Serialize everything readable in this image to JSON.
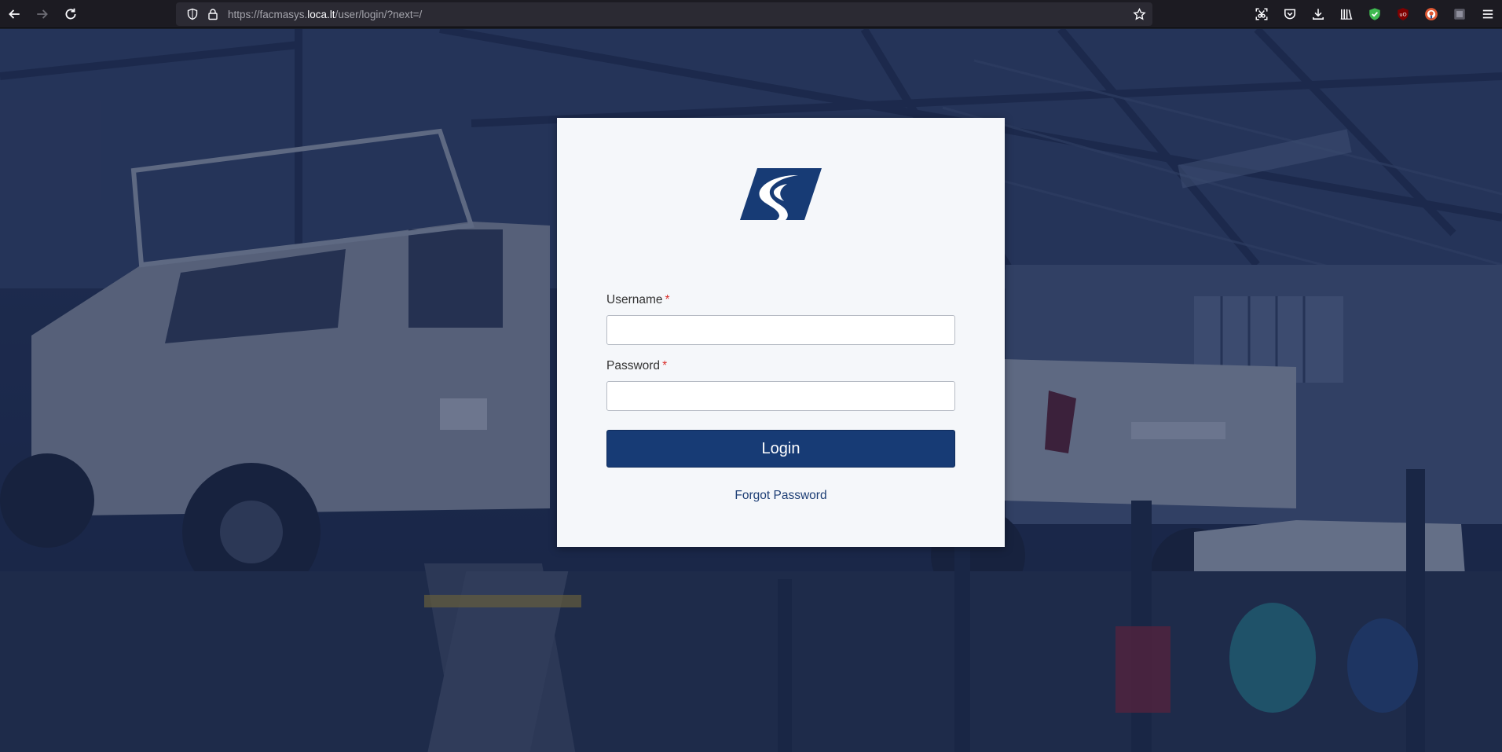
{
  "browser": {
    "url_prefix": "https://facmasys.",
    "url_host": "loca.lt",
    "url_path": "/user/login/?next=/",
    "nav_icons": [
      "back-arrow-icon",
      "forward-arrow-icon",
      "reload-icon"
    ],
    "url_icons": [
      "shield-icon",
      "lock-icon"
    ],
    "toolbar_icons": [
      "screenshot-icon",
      "pocket-icon",
      "download-icon",
      "library-icon",
      "shield-extension-icon",
      "ublock-origin-icon",
      "duckduckgo-icon",
      "extension-icon",
      "menu-icon"
    ],
    "ublock_badge": "uO"
  },
  "login": {
    "logo": "company-logo",
    "username_label": "Username",
    "username_value": "",
    "password_label": "Password",
    "password_value": "",
    "required_marker": "*",
    "login_button": "Login",
    "forgot_password": "Forgot Password"
  },
  "colors": {
    "primary": "#173b75",
    "link": "#1d3e75",
    "required": "#d9302c",
    "overlay": "#14244e"
  }
}
